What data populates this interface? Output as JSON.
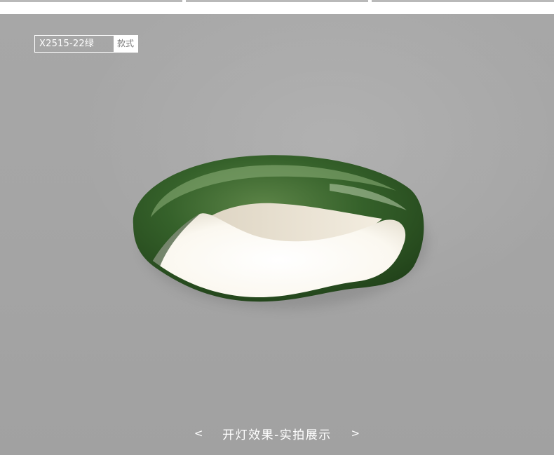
{
  "variant": {
    "code": "X2515-22绿",
    "label": "款式"
  },
  "gallery": {
    "caption": "开灯效果-实拍展示",
    "prev_symbol": "<",
    "next_symbol": ">"
  },
  "colors": {
    "lamp_shell": "#2f5a23",
    "lamp_highlight": "#7aa066",
    "lamp_light": "#fbf8f0",
    "ceiling": "#a6a6a6"
  }
}
